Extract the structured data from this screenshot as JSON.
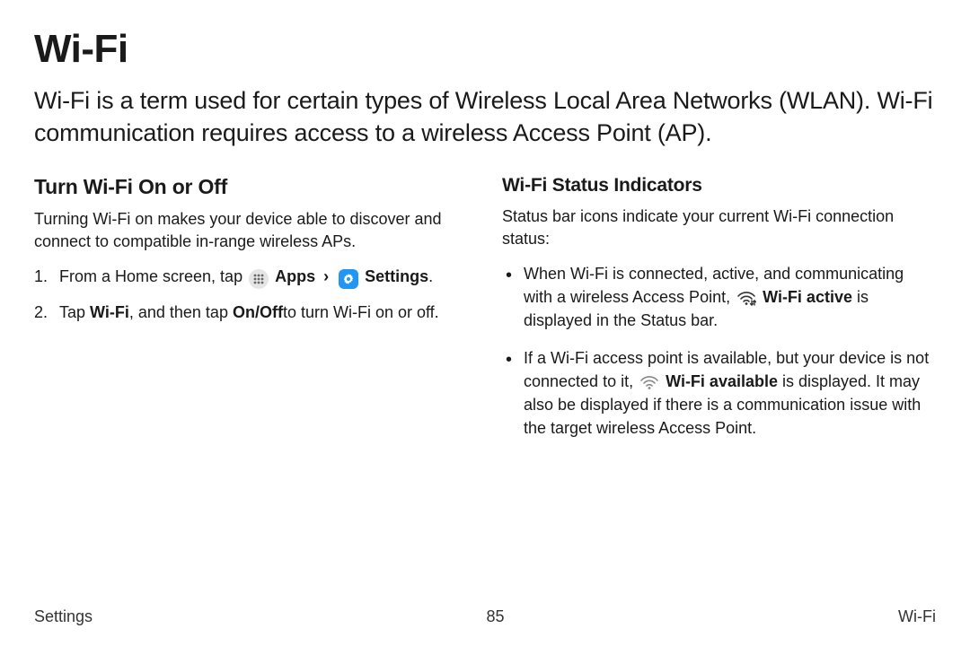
{
  "title": "Wi-Fi",
  "intro": "Wi-Fi is a term used for certain types of Wireless Local Area Networks (WLAN). Wi-Fi communication requires access to a wireless Access Point (AP).",
  "left": {
    "heading": "Turn Wi-Fi On or Off",
    "lead": "Turning Wi-Fi on makes your device able to discover and connect to compatible in-range wireless APs.",
    "step1_pre": "From a Home screen, tap ",
    "step1_apps": "Apps",
    "step1_settings": "Settings",
    "step1_post": ".",
    "step2_a": "Tap ",
    "step2_b": "Wi-Fi",
    "step2_c": ", and then tap ",
    "step2_d": "On/Off",
    "step2_e": "to turn Wi-Fi on or off."
  },
  "right": {
    "heading": "Wi-Fi Status Indicators",
    "lead": "Status bar icons indicate your current Wi-Fi connection status:",
    "b1_a": "When Wi-Fi is connected, active, and communicating with a wireless Access Point, ",
    "b1_b": "Wi-Fi active",
    "b1_c": "  is displayed in the Status bar.",
    "b2_a": "If a Wi-Fi access point is available, but your device is not connected to it, ",
    "b2_b": "Wi-Fi available",
    "b2_c": " is displayed. It may also be displayed if there is a communication issue with the target wireless Access Point."
  },
  "footer": {
    "left": "Settings",
    "center": "85",
    "right": "Wi-Fi"
  }
}
